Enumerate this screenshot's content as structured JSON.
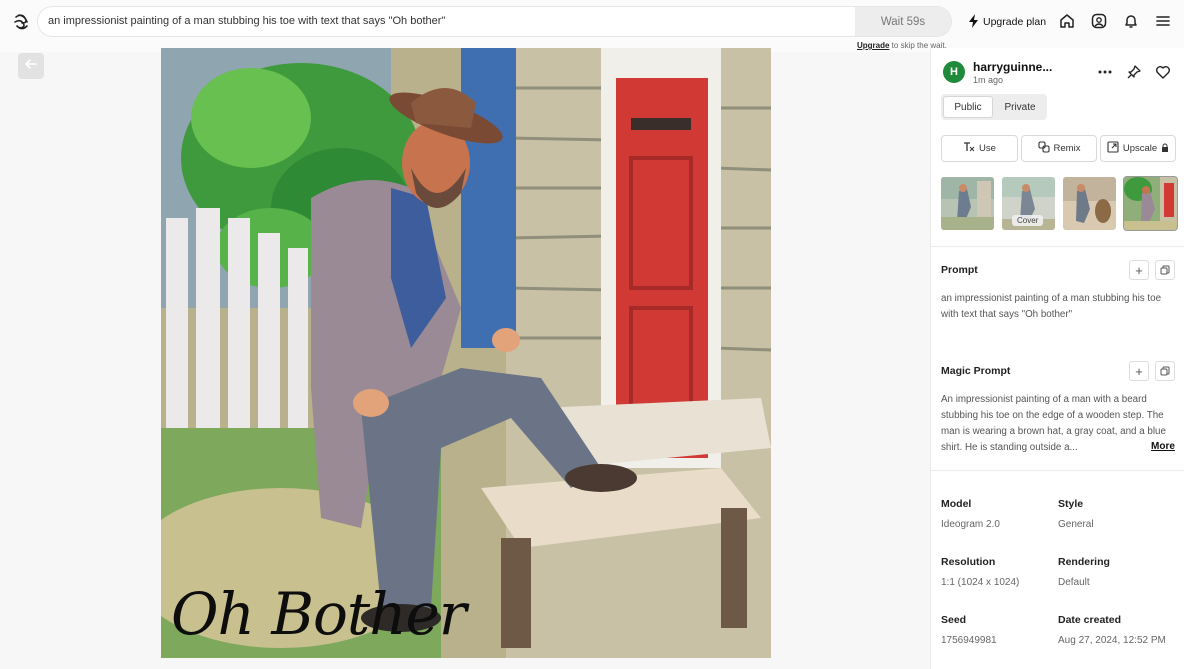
{
  "top_bar": {
    "prompt": "an impressionist painting of a man stubbing his toe with text that says \"Oh bother\"",
    "wait_label": "Wait 59s",
    "upgrade_note_link": "Upgrade",
    "upgrade_note_rest": " to skip the wait.",
    "upgrade_plan_label": "Upgrade plan",
    "icons": [
      "menu-logo-icon",
      "bolt-icon",
      "home-icon",
      "gallery-icon",
      "bell-icon",
      "hamburger-menu-icon"
    ]
  },
  "image": {
    "overlay_text": "Oh Bother"
  },
  "panel": {
    "avatar_letter": "H",
    "avatar_color": "#1f8a3a",
    "username": "harryguinne...",
    "time_ago": "1m ago",
    "visibility": {
      "public_label": "Public",
      "private_label": "Private",
      "selected": "Public"
    },
    "actions": {
      "use_label": "Use",
      "remix_label": "Remix",
      "upscale_label": "Upscale"
    },
    "thumbnails": {
      "cover_label": "Cover",
      "selected_index": 3
    },
    "prompt": {
      "title": "Prompt",
      "text": "an impressionist painting of a man stubbing his toe with text that says \"Oh bother\""
    },
    "magic_prompt": {
      "title": "Magic Prompt",
      "text": "An impressionist painting of a man with a beard stubbing his toe on the edge of a wooden step. The man is wearing a brown hat, a gray coat, and a blue shirt. He is standing outside a...",
      "more_label": "More"
    },
    "meta": {
      "model_label": "Model",
      "model_value": "Ideogram 2.0",
      "style_label": "Style",
      "style_value": "General",
      "resolution_label": "Resolution",
      "resolution_value": "1:1 (1024 x 1024)",
      "rendering_label": "Rendering",
      "rendering_value": "Default",
      "seed_label": "Seed",
      "seed_value": "1756949981",
      "date_label": "Date created",
      "date_value": "Aug 27, 2024, 12:52 PM"
    }
  }
}
